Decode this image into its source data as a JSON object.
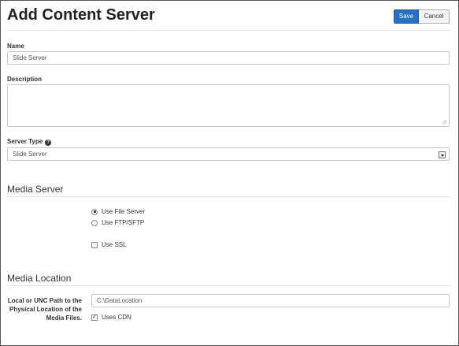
{
  "header": {
    "title": "Add Content Server",
    "save_label": "Save",
    "cancel_label": "Cancel"
  },
  "form": {
    "name": {
      "label": "Name",
      "value": "Slide Server"
    },
    "description": {
      "label": "Description",
      "value": ""
    },
    "server_type": {
      "label": "Server Type",
      "selected": "Slide Server"
    }
  },
  "media_server": {
    "heading": "Media Server",
    "options": [
      {
        "label": "Use File Server",
        "checked": true
      },
      {
        "label": "Use FTP/SFTP",
        "checked": false
      }
    ],
    "ssl": {
      "label": "Use SSL",
      "checked": false
    }
  },
  "media_location": {
    "heading": "Media Location",
    "path_label_line1": "Local or UNC Path to the",
    "path_label_line2": "Physical Location of the",
    "path_label_line3": "Media Files.",
    "path_value": "C:\\DataLocation",
    "cdn": {
      "label": "Uses CDN",
      "checked": true
    }
  },
  "icons": {
    "help": "question-circle-icon",
    "select": "chevron-down-icon",
    "resize": "resize-grip-icon"
  },
  "colors": {
    "primary": "#2a70c2",
    "border": "#c8c8c8"
  }
}
